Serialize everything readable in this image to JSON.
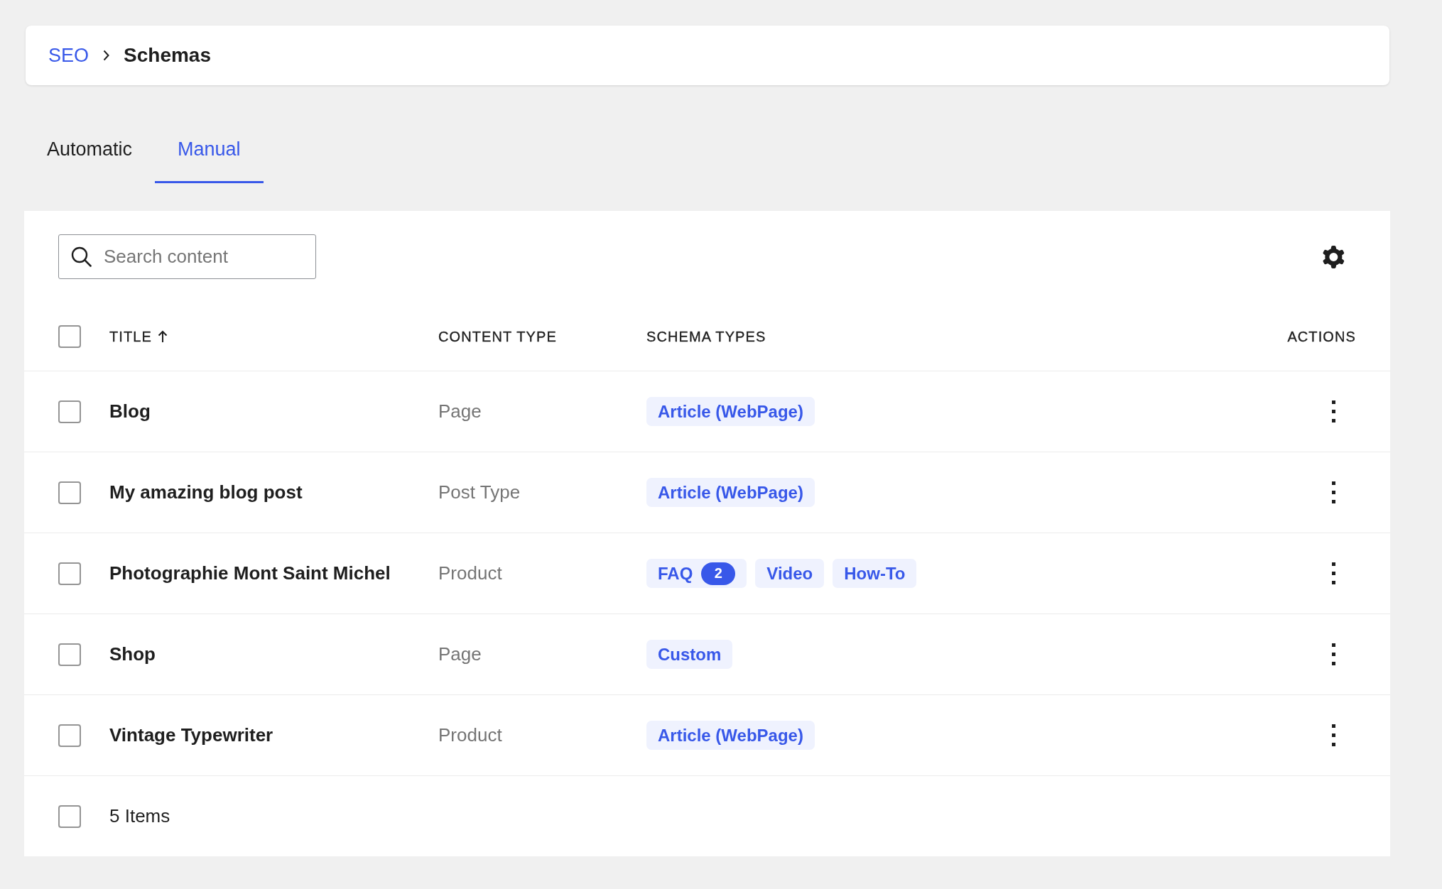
{
  "breadcrumb": {
    "items": [
      {
        "label": "SEO",
        "kind": "link"
      },
      {
        "label": "Schemas",
        "kind": "current"
      }
    ]
  },
  "tabs": [
    {
      "label": "Automatic",
      "selected": false
    },
    {
      "label": "Manual",
      "selected": true
    }
  ],
  "search": {
    "placeholder": "Search content"
  },
  "table": {
    "select_all": {
      "checked": false
    },
    "columns": [
      {
        "label": "TITLE",
        "sorted": true
      },
      {
        "label": "CONTENT TYPE"
      },
      {
        "label": "SCHEMA TYPES"
      },
      {
        "label": "ACTIONS"
      }
    ],
    "rows": [
      {
        "checked": false,
        "title": "Blog",
        "content_type": "Page",
        "schema_types": [
          {
            "label": "Article (WebPage)"
          }
        ]
      },
      {
        "checked": false,
        "title": "My amazing blog post",
        "content_type": "Post Type",
        "schema_types": [
          {
            "label": "Article (WebPage)"
          }
        ]
      },
      {
        "checked": false,
        "title": "Photographie Mont Saint Michel",
        "content_type": "Product",
        "schema_types": [
          {
            "label": "FAQ",
            "count": "2"
          },
          {
            "label": "Video"
          },
          {
            "label": "How-To"
          }
        ]
      },
      {
        "checked": false,
        "title": "Shop",
        "content_type": "Page",
        "schema_types": [
          {
            "label": "Custom"
          }
        ]
      },
      {
        "checked": false,
        "title": "Vintage Typewriter",
        "content_type": "Product",
        "schema_types": [
          {
            "label": "Article (WebPage)"
          }
        ]
      }
    ],
    "footer": {
      "checked": false,
      "count": "5 Items"
    }
  }
}
